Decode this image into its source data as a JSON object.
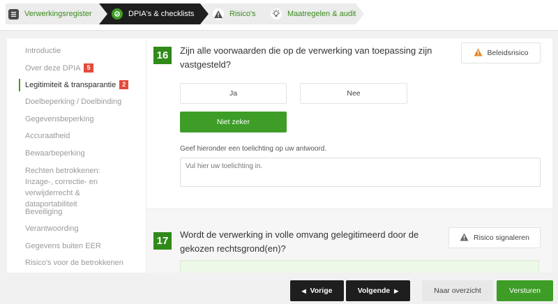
{
  "breadcrumb": [
    {
      "label": "Verwerkingsregister",
      "icon": "register-icon",
      "state": "done"
    },
    {
      "label": "DPIA's & checklists",
      "icon": "checklist-icon",
      "state": "current"
    },
    {
      "label": "Risico's",
      "icon": "warning-icon",
      "state": "upcoming"
    },
    {
      "label": "Maatregelen & audit",
      "icon": "lightbulb-icon",
      "state": "upcoming"
    }
  ],
  "sidebar": {
    "items": [
      {
        "label": "Introductie"
      },
      {
        "label": "Over deze DPIA",
        "badge": "5"
      },
      {
        "label": "Legitimiteit & transparantie",
        "badge": "2",
        "active": true
      },
      {
        "label": "Doelbeperking / Doelbinding"
      },
      {
        "label": "Gegevensbeperking"
      },
      {
        "label": "Accuraatheid"
      },
      {
        "label": "Bewaarbeperking"
      },
      {
        "label": "Rechten betrokkenen: Inzage-, correctie- en verwijderrecht & dataportabiliteit"
      },
      {
        "label": "Beveiliging"
      },
      {
        "label": "Verantwoording"
      },
      {
        "label": "Gegevens buiten EER"
      },
      {
        "label": "Risico's voor de betrokkenen"
      }
    ]
  },
  "questions": [
    {
      "number": "16",
      "text": "Zijn alle voorwaarden die op de verwerking van toepassing zijn vastgesteld?",
      "flag_label": "Beleidsrisico",
      "options": [
        "Ja",
        "Nee",
        "Niet zeker"
      ],
      "selected": "Niet zeker",
      "explanation_label": "Geef hieronder een toelichting op uw antwoord.",
      "explanation_placeholder": "Vul hier uw toelichting in."
    },
    {
      "number": "17",
      "text": "Wordt de verwerking in volle omvang gelegitimeerd door de gekozen rechtsgrond(en)?",
      "flag_label": "Risico signaleren"
    }
  ],
  "footer": {
    "prev_label": "Vorige",
    "next_label": "Volgende",
    "overview_label": "Naar overzicht",
    "submit_label": "Versturen"
  },
  "colors": {
    "accent_green": "#3d9d27",
    "dark": "#1e1e1e",
    "badge_red": "#e24b3b",
    "warning_orange": "#e8842a"
  }
}
